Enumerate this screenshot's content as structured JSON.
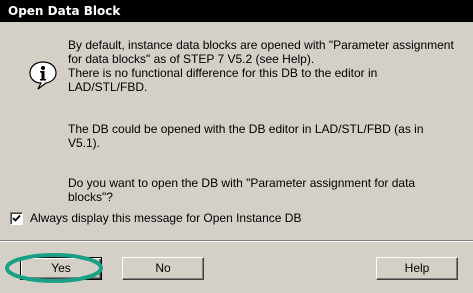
{
  "dialog": {
    "title": "Open Data Block",
    "icon": "info-icon",
    "message_1": [
      "By default, instance data blocks are opened with \"Parameter assignment",
      "for data blocks\" as of STEP 7 V5.2 (see Help).",
      "There is no functional difference for this DB to the editor in",
      "LAD/STL/FBD."
    ],
    "message_2": [
      "The DB could be opened with the DB editor in LAD/STL/FBD (as in",
      "V5.1)."
    ],
    "message_3": [
      "Do you want to open the DB with \"Parameter assignment for data",
      "blocks\"?"
    ],
    "checkbox_label": "Always display this message for Open Instance DB",
    "checkbox_checked": true
  },
  "buttons": {
    "yes": "Yes",
    "no": "No",
    "help": "Help"
  },
  "colors": {
    "title_bg": "#000000",
    "dialog_bg": "#d4d0c8",
    "highlight_ring": "#1aa085"
  }
}
